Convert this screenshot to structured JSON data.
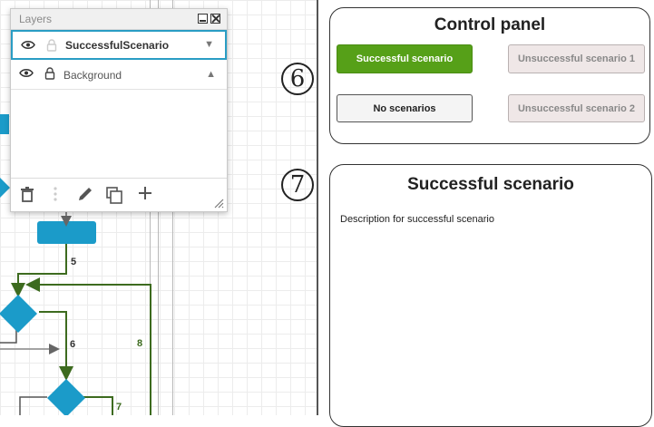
{
  "layers_panel": {
    "title": "Layers",
    "layers": [
      {
        "name": "SuccessfulScenario",
        "selected": true,
        "arrow": "▼"
      },
      {
        "name": "Background",
        "selected": false,
        "arrow": "▲"
      }
    ]
  },
  "diagram": {
    "edge_labels": [
      "5",
      "6",
      "8",
      "7"
    ],
    "colors": {
      "node": "#1b9bc9",
      "edge": "#555555",
      "highlight_edge": "#3d6b1f"
    }
  },
  "step_markers": [
    "6",
    "7"
  ],
  "control_panel": {
    "title": "Control panel",
    "buttons": {
      "successful": "Successful scenario",
      "unsuccessful_1": "Unsuccessful scenario 1",
      "no_scenarios": "No scenarios",
      "unsuccessful_2": "Unsuccessful scenario 2"
    },
    "colors": {
      "active": "#56a018"
    }
  },
  "scenario_panel": {
    "title": "Successful scenario",
    "description": "Description for successful scenario"
  }
}
